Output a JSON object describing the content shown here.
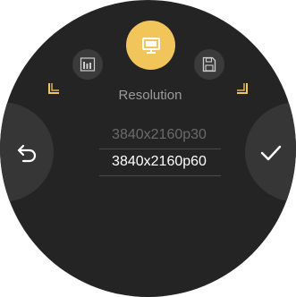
{
  "header": {
    "title": "Resolution"
  },
  "modes": [
    {
      "name": "chart",
      "icon": "bar-chart-icon",
      "selected": false
    },
    {
      "name": "display",
      "icon": "monitor-icon",
      "selected": true
    },
    {
      "name": "storage",
      "icon": "save-icon",
      "selected": false
    }
  ],
  "options": [
    {
      "label": "3840x2160p30",
      "state": "dimmed"
    },
    {
      "label": "3840x2160p60",
      "state": "selected"
    }
  ],
  "actions": {
    "back_icon": "back-arrow-icon",
    "confirm_icon": "checkmark-icon"
  },
  "colors": {
    "background": "#242424",
    "side_button": "#363636",
    "accent": "#f1c55a",
    "title_text": "#9b9b9b",
    "selected_text": "#ffffff",
    "dimmed_text": "#6a6a6a"
  }
}
